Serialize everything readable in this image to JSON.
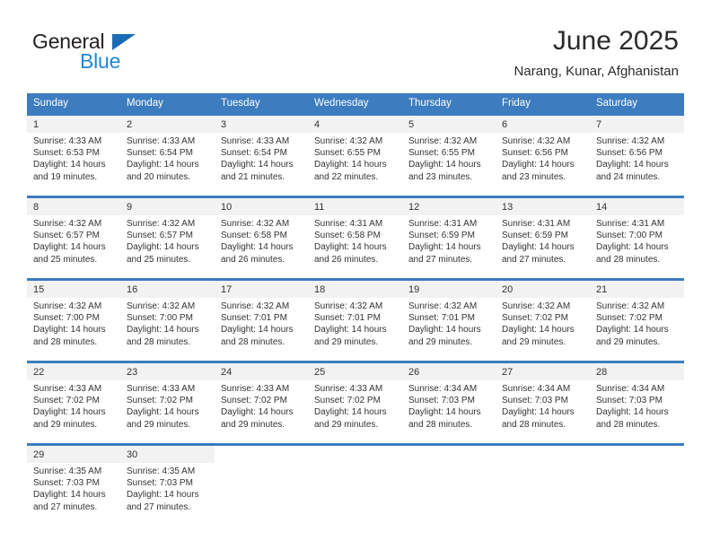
{
  "brand": {
    "name_part1": "General",
    "name_part2": "Blue",
    "triangle_icon": "triangle-icon",
    "color_dark": "#231f20",
    "color_blue": "#1e87d6"
  },
  "header": {
    "title": "June 2025",
    "subtitle": "Narang, Kunar, Afghanistan"
  },
  "theme": {
    "header_bg": "#3c7cbf",
    "daynum_bg": "#f2f2f2",
    "text": "#333333"
  },
  "calendar": {
    "weekday_headers": [
      "Sunday",
      "Monday",
      "Tuesday",
      "Wednesday",
      "Thursday",
      "Friday",
      "Saturday"
    ],
    "weeks": [
      {
        "days": [
          {
            "num": "1",
            "sunrise": "Sunrise: 4:33 AM",
            "sunset": "Sunset: 6:53 PM",
            "daylight1": "Daylight: 14 hours",
            "daylight2": "and 19 minutes."
          },
          {
            "num": "2",
            "sunrise": "Sunrise: 4:33 AM",
            "sunset": "Sunset: 6:54 PM",
            "daylight1": "Daylight: 14 hours",
            "daylight2": "and 20 minutes."
          },
          {
            "num": "3",
            "sunrise": "Sunrise: 4:33 AM",
            "sunset": "Sunset: 6:54 PM",
            "daylight1": "Daylight: 14 hours",
            "daylight2": "and 21 minutes."
          },
          {
            "num": "4",
            "sunrise": "Sunrise: 4:32 AM",
            "sunset": "Sunset: 6:55 PM",
            "daylight1": "Daylight: 14 hours",
            "daylight2": "and 22 minutes."
          },
          {
            "num": "5",
            "sunrise": "Sunrise: 4:32 AM",
            "sunset": "Sunset: 6:55 PM",
            "daylight1": "Daylight: 14 hours",
            "daylight2": "and 23 minutes."
          },
          {
            "num": "6",
            "sunrise": "Sunrise: 4:32 AM",
            "sunset": "Sunset: 6:56 PM",
            "daylight1": "Daylight: 14 hours",
            "daylight2": "and 23 minutes."
          },
          {
            "num": "7",
            "sunrise": "Sunrise: 4:32 AM",
            "sunset": "Sunset: 6:56 PM",
            "daylight1": "Daylight: 14 hours",
            "daylight2": "and 24 minutes."
          }
        ]
      },
      {
        "days": [
          {
            "num": "8",
            "sunrise": "Sunrise: 4:32 AM",
            "sunset": "Sunset: 6:57 PM",
            "daylight1": "Daylight: 14 hours",
            "daylight2": "and 25 minutes."
          },
          {
            "num": "9",
            "sunrise": "Sunrise: 4:32 AM",
            "sunset": "Sunset: 6:57 PM",
            "daylight1": "Daylight: 14 hours",
            "daylight2": "and 25 minutes."
          },
          {
            "num": "10",
            "sunrise": "Sunrise: 4:32 AM",
            "sunset": "Sunset: 6:58 PM",
            "daylight1": "Daylight: 14 hours",
            "daylight2": "and 26 minutes."
          },
          {
            "num": "11",
            "sunrise": "Sunrise: 4:31 AM",
            "sunset": "Sunset: 6:58 PM",
            "daylight1": "Daylight: 14 hours",
            "daylight2": "and 26 minutes."
          },
          {
            "num": "12",
            "sunrise": "Sunrise: 4:31 AM",
            "sunset": "Sunset: 6:59 PM",
            "daylight1": "Daylight: 14 hours",
            "daylight2": "and 27 minutes."
          },
          {
            "num": "13",
            "sunrise": "Sunrise: 4:31 AM",
            "sunset": "Sunset: 6:59 PM",
            "daylight1": "Daylight: 14 hours",
            "daylight2": "and 27 minutes."
          },
          {
            "num": "14",
            "sunrise": "Sunrise: 4:31 AM",
            "sunset": "Sunset: 7:00 PM",
            "daylight1": "Daylight: 14 hours",
            "daylight2": "and 28 minutes."
          }
        ]
      },
      {
        "days": [
          {
            "num": "15",
            "sunrise": "Sunrise: 4:32 AM",
            "sunset": "Sunset: 7:00 PM",
            "daylight1": "Daylight: 14 hours",
            "daylight2": "and 28 minutes."
          },
          {
            "num": "16",
            "sunrise": "Sunrise: 4:32 AM",
            "sunset": "Sunset: 7:00 PM",
            "daylight1": "Daylight: 14 hours",
            "daylight2": "and 28 minutes."
          },
          {
            "num": "17",
            "sunrise": "Sunrise: 4:32 AM",
            "sunset": "Sunset: 7:01 PM",
            "daylight1": "Daylight: 14 hours",
            "daylight2": "and 28 minutes."
          },
          {
            "num": "18",
            "sunrise": "Sunrise: 4:32 AM",
            "sunset": "Sunset: 7:01 PM",
            "daylight1": "Daylight: 14 hours",
            "daylight2": "and 29 minutes."
          },
          {
            "num": "19",
            "sunrise": "Sunrise: 4:32 AM",
            "sunset": "Sunset: 7:01 PM",
            "daylight1": "Daylight: 14 hours",
            "daylight2": "and 29 minutes."
          },
          {
            "num": "20",
            "sunrise": "Sunrise: 4:32 AM",
            "sunset": "Sunset: 7:02 PM",
            "daylight1": "Daylight: 14 hours",
            "daylight2": "and 29 minutes."
          },
          {
            "num": "21",
            "sunrise": "Sunrise: 4:32 AM",
            "sunset": "Sunset: 7:02 PM",
            "daylight1": "Daylight: 14 hours",
            "daylight2": "and 29 minutes."
          }
        ]
      },
      {
        "days": [
          {
            "num": "22",
            "sunrise": "Sunrise: 4:33 AM",
            "sunset": "Sunset: 7:02 PM",
            "daylight1": "Daylight: 14 hours",
            "daylight2": "and 29 minutes."
          },
          {
            "num": "23",
            "sunrise": "Sunrise: 4:33 AM",
            "sunset": "Sunset: 7:02 PM",
            "daylight1": "Daylight: 14 hours",
            "daylight2": "and 29 minutes."
          },
          {
            "num": "24",
            "sunrise": "Sunrise: 4:33 AM",
            "sunset": "Sunset: 7:02 PM",
            "daylight1": "Daylight: 14 hours",
            "daylight2": "and 29 minutes."
          },
          {
            "num": "25",
            "sunrise": "Sunrise: 4:33 AM",
            "sunset": "Sunset: 7:02 PM",
            "daylight1": "Daylight: 14 hours",
            "daylight2": "and 29 minutes."
          },
          {
            "num": "26",
            "sunrise": "Sunrise: 4:34 AM",
            "sunset": "Sunset: 7:03 PM",
            "daylight1": "Daylight: 14 hours",
            "daylight2": "and 28 minutes."
          },
          {
            "num": "27",
            "sunrise": "Sunrise: 4:34 AM",
            "sunset": "Sunset: 7:03 PM",
            "daylight1": "Daylight: 14 hours",
            "daylight2": "and 28 minutes."
          },
          {
            "num": "28",
            "sunrise": "Sunrise: 4:34 AM",
            "sunset": "Sunset: 7:03 PM",
            "daylight1": "Daylight: 14 hours",
            "daylight2": "and 28 minutes."
          }
        ]
      },
      {
        "days": [
          {
            "num": "29",
            "sunrise": "Sunrise: 4:35 AM",
            "sunset": "Sunset: 7:03 PM",
            "daylight1": "Daylight: 14 hours",
            "daylight2": "and 27 minutes."
          },
          {
            "num": "30",
            "sunrise": "Sunrise: 4:35 AM",
            "sunset": "Sunset: 7:03 PM",
            "daylight1": "Daylight: 14 hours",
            "daylight2": "and 27 minutes."
          },
          {
            "num": "",
            "sunrise": "",
            "sunset": "",
            "daylight1": "",
            "daylight2": ""
          },
          {
            "num": "",
            "sunrise": "",
            "sunset": "",
            "daylight1": "",
            "daylight2": ""
          },
          {
            "num": "",
            "sunrise": "",
            "sunset": "",
            "daylight1": "",
            "daylight2": ""
          },
          {
            "num": "",
            "sunrise": "",
            "sunset": "",
            "daylight1": "",
            "daylight2": ""
          },
          {
            "num": "",
            "sunrise": "",
            "sunset": "",
            "daylight1": "",
            "daylight2": ""
          }
        ]
      }
    ]
  }
}
